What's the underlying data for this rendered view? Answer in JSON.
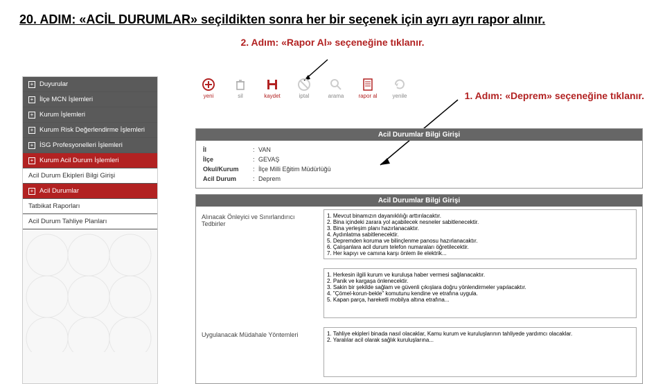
{
  "title_prefix": "20. ADIM:",
  "title_rest": " «ACİL DURUMLAR» seçildikten sonra her bir seçenek için ayrı ayrı rapor alınır.",
  "step2": "2. Adım: «Rapor Al» seçeneğine tıklanır.",
  "step1": "1. Adım: «Deprem» seçeneğine tıklanır.",
  "sidebar": {
    "items": [
      {
        "label": "Duyurular",
        "cls": "dark"
      },
      {
        "label": "İlçe MCN İşlemleri",
        "cls": "dark"
      },
      {
        "label": "Kurum İşlemleri",
        "cls": "dark"
      },
      {
        "label": "Kurum Risk Değerlendirme İşlemleri",
        "cls": "dark"
      },
      {
        "label": "İSG Profesyonelleri İşlemleri",
        "cls": "dark"
      },
      {
        "label": "Kurum Acil Durum İşlemleri",
        "cls": "red"
      },
      {
        "label": "Acil Durum Ekipleri Bilgi Girişi",
        "cls": "white"
      },
      {
        "label": "Acil Durumlar",
        "cls": "red"
      },
      {
        "label": "Tatbikat Raporları",
        "cls": "white"
      },
      {
        "label": "Acil Durum Tahliye Planları",
        "cls": "white"
      }
    ]
  },
  "toolbar": [
    {
      "label": "yeni",
      "icon": "plus",
      "red": true
    },
    {
      "label": "sil",
      "icon": "trash"
    },
    {
      "label": "kaydet",
      "icon": "save",
      "red": true
    },
    {
      "label": "iptal",
      "icon": "cancel"
    },
    {
      "label": "arama",
      "icon": "search"
    },
    {
      "label": "rapor al",
      "icon": "report",
      "red": true
    },
    {
      "label": "yenile",
      "icon": "refresh"
    }
  ],
  "panel1": {
    "title": "Acil Durumlar Bilgi Girişi",
    "rows": [
      {
        "k": "İl",
        "v": "VAN"
      },
      {
        "k": "İlçe",
        "v": "GEVAŞ"
      },
      {
        "k": "Okul/Kurum",
        "v": "İlçe Milli Eğitim Müdürlüğü"
      },
      {
        "k": "Acil Durum",
        "v": "Deprem"
      }
    ]
  },
  "panel2": {
    "title": "Acil Durumlar Bilgi Girişi",
    "fields": [
      {
        "label": "Alınacak Önleyici ve Sınırlandırıcı Tedbirler",
        "value": "1. Mevcut binamızın dayanıklılığı arttırılacaktır.\n2. Bina içindeki zarara yol açabilecek nesneler sabitlenecektir.\n3. Bina yerleşim planı hazırlanacaktır.\n4. Aydınlatma sabitlenecektir.\n5. Depremden koruma ve bilinçlenme panosu hazırlanacaktır.\n6. Çalışanlara acil durum telefon numaraları öğretilecektir.\n7. Her kapıyı ve camına karşı önlem ile elektrik..."
      },
      {
        "label": "",
        "value": "1. Herkesin ilgili kurum ve kuruluşa haber vermesi sağlanacaktır.\n2. Panik ve kargaşa önlenecektir.\n3. Sakin bir şekilde sağlam ve güvenli çıkışlara doğru yönlendirmeler yapılacaktır.\n4. \"Çömel-korun-bekle\" komutunu kendine ve etrafına uygula.\n5. Kapan parça, hareketli mobilya altına etrafına..."
      },
      {
        "label": "Uygulanacak Müdahale Yöntemleri",
        "value": "1. Tahliye ekipleri binada nasıl olacaklar, Kamu kurum ve kuruluşlarının tahliyede yardımcı olacaklar.\n2. Yaralılar acil olarak sağlık kuruluşlarına..."
      }
    ]
  }
}
